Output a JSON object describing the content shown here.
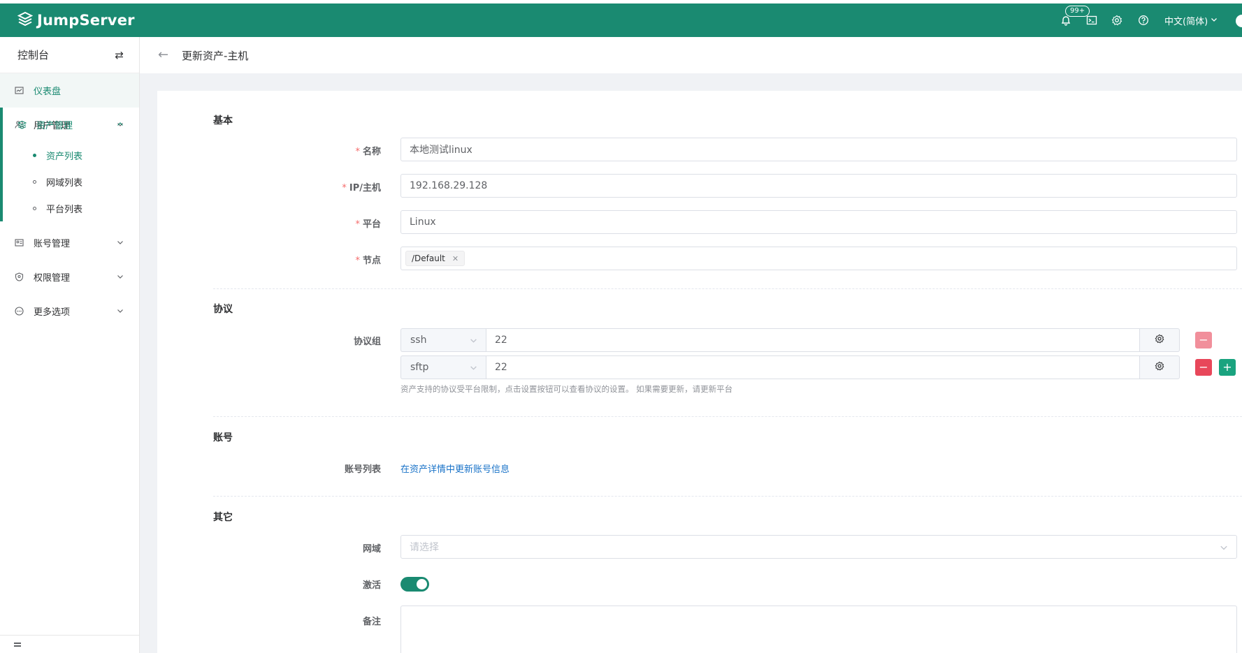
{
  "app": {
    "title": "JumpServer",
    "notification_badge": "99+",
    "language": "中文(简体)",
    "brand_color": "#1a8a71"
  },
  "sidebar": {
    "header": "控制台",
    "items": [
      {
        "label": "仪表盘",
        "icon": "dashboard-icon"
      },
      {
        "label": "用户管理",
        "icon": "users-icon"
      },
      {
        "label": "资产管理",
        "icon": "layers-icon",
        "expanded": true,
        "children": [
          {
            "label": "资产列表",
            "active": true
          },
          {
            "label": "网域列表"
          },
          {
            "label": "平台列表"
          }
        ]
      },
      {
        "label": "账号管理",
        "icon": "account-icon"
      },
      {
        "label": "权限管理",
        "icon": "shield-icon"
      },
      {
        "label": "更多选项",
        "icon": "more-icon"
      }
    ]
  },
  "page": {
    "title": "更新资产-主机"
  },
  "form": {
    "basic": {
      "section": "基本",
      "name_label": "名称",
      "name_value": "本地测试linux",
      "ip_label": "IP/主机",
      "ip_value": "192.168.29.128",
      "platform_label": "平台",
      "platform_value": "Linux",
      "nodes_label": "节点",
      "nodes_tag": "/Default"
    },
    "protocol": {
      "section": "协议",
      "group_label": "协议组",
      "rows": [
        {
          "name": "ssh",
          "port": "22"
        },
        {
          "name": "sftp",
          "port": "22"
        }
      ],
      "help": "资产支持的协议受平台限制，点击设置按钮可以查看协议的设置。 如果需要更新，请更新平台"
    },
    "account": {
      "section": "账号",
      "list_label": "账号列表",
      "link_text": "在资产详情中更新账号信息"
    },
    "other": {
      "section": "其它",
      "domain_label": "网域",
      "domain_placeholder": "请选择",
      "active_label": "激活",
      "active": true,
      "comment_label": "备注"
    }
  }
}
